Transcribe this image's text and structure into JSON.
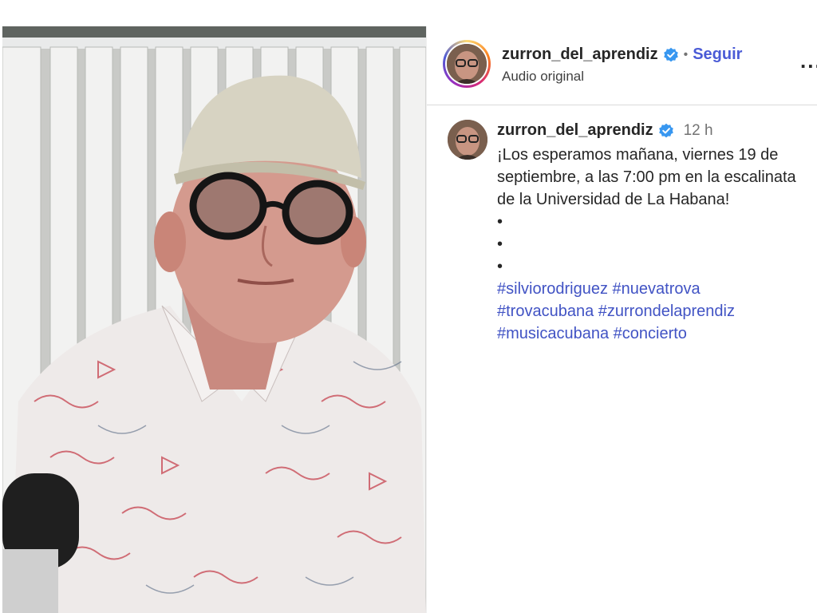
{
  "post": {
    "username": "zurron_del_aprendiz",
    "separator": "•",
    "follow_label": "Seguir",
    "audio_label": "Audio original",
    "more_label": "...",
    "time": "12 h",
    "caption": "¡Los esperamos mañana, viernes 19 de septiembre, a las 7:00 pm en la escalinata de la Universidad de La Habana!",
    "bullets": [
      "•",
      "•",
      "•"
    ],
    "hashtags": [
      "#silviorodriguez",
      "#nuevatrova",
      "#trovacubana",
      "#zurrondelaprendiz",
      "#musicacubana",
      "#concierto"
    ]
  },
  "colors": {
    "verified_badge": "#3897f0",
    "follow_link": "#4a5bd6",
    "hashtag": "#4153c4"
  }
}
